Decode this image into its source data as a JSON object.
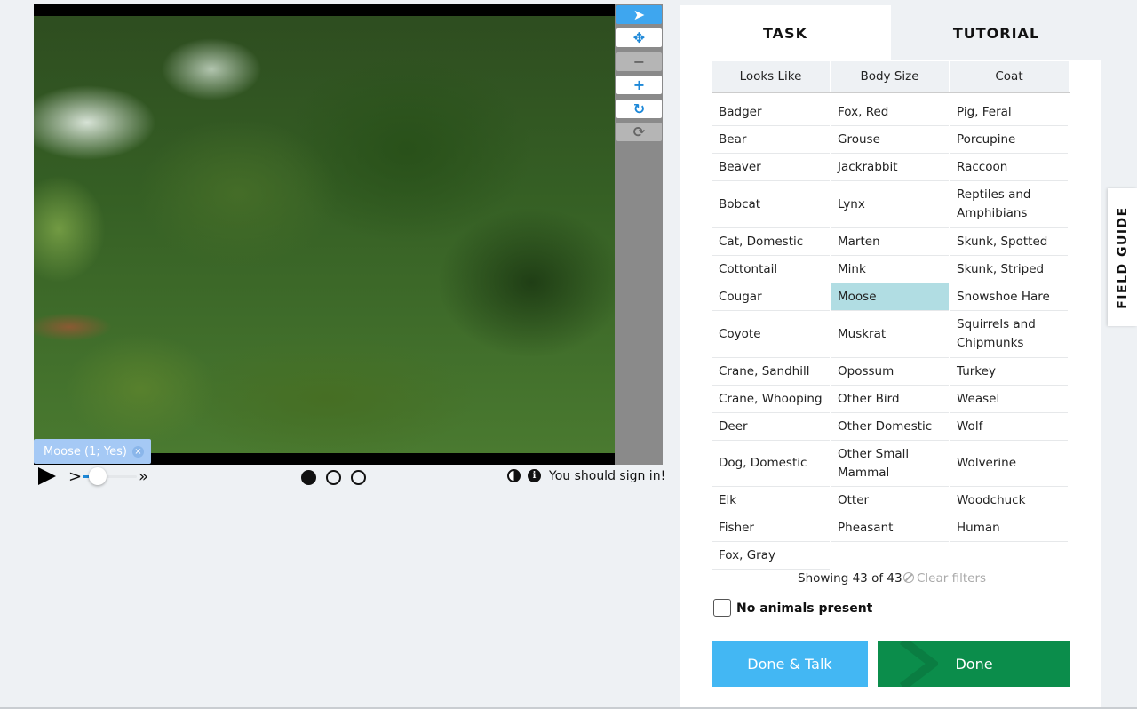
{
  "viewer": {
    "tag_label": "Moose (1; Yes)",
    "tag_close": "×",
    "signin_text": "You should sign in!",
    "info_glyph": "i",
    "frames": [
      {
        "active": true
      },
      {
        "active": false
      },
      {
        "active": false
      }
    ],
    "toolbar": [
      {
        "icon": "pointer-icon",
        "glyph": "➤",
        "state": "active"
      },
      {
        "icon": "move-icon",
        "glyph": "✥",
        "state": "normal"
      },
      {
        "icon": "zoom-out-icon",
        "glyph": "−",
        "state": "disabled"
      },
      {
        "icon": "zoom-in-icon",
        "glyph": "+",
        "state": "normal"
      },
      {
        "icon": "rotate-icon",
        "glyph": "↻",
        "state": "normal"
      },
      {
        "icon": "reset-icon",
        "glyph": "⟳",
        "state": "disabled"
      }
    ],
    "step_glyph": ">",
    "fast_glyph": "»"
  },
  "tabs": {
    "task": "TASK",
    "tutorial": "TUTORIAL"
  },
  "filters": [
    "Looks Like",
    "Body Size",
    "Coat"
  ],
  "species": [
    [
      "Badger",
      "Fox, Red",
      "Pig, Feral"
    ],
    [
      "Bear",
      "Grouse",
      "Porcupine"
    ],
    [
      "Beaver",
      "Jackrabbit",
      "Raccoon"
    ],
    [
      "Bobcat",
      "Lynx",
      "Reptiles and Amphibians"
    ],
    [
      "Cat, Domestic",
      "Marten",
      "Skunk, Spotted"
    ],
    [
      "Cottontail",
      "Mink",
      "Skunk, Striped"
    ],
    [
      "Cougar",
      "Moose",
      "Snowshoe Hare"
    ],
    [
      "Coyote",
      "Muskrat",
      "Squirrels and Chipmunks"
    ],
    [
      "Crane, Sandhill",
      "Opossum",
      "Turkey"
    ],
    [
      "Crane, Whooping",
      "Other Bird",
      "Weasel"
    ],
    [
      "Deer",
      "Other Domestic",
      "Wolf"
    ],
    [
      "Dog, Domestic",
      "Other Small Mammal",
      "Wolverine"
    ],
    [
      "Elk",
      "Otter",
      "Woodchuck"
    ],
    [
      "Fisher",
      "Pheasant",
      "Human"
    ],
    [
      "Fox, Gray",
      "",
      ""
    ]
  ],
  "selected_species": "Moose",
  "showing_text": "Showing 43 of 43",
  "clear_filters": "Clear filters",
  "no_animals_label": "No animals present",
  "no_animals_checked": false,
  "buttons": {
    "done_talk": "Done & Talk",
    "done": "Done"
  },
  "field_guide": "FIELD GUIDE",
  "colors": {
    "accent_blue": "#43b7f3",
    "done_green": "#0b8d4b",
    "selected_cell": "#b1dde3",
    "tag_blue": "#a5c9f5"
  }
}
